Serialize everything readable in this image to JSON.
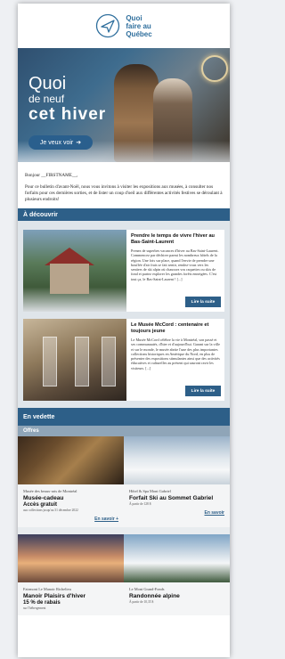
{
  "header": {
    "logo_icon": "compass-arrow-icon",
    "logo_line1": "Quoi",
    "logo_line2": "faire au",
    "logo_line3": "Québec",
    "brand_color": "#2f6f9d"
  },
  "hero": {
    "title_line1": "Quoi",
    "title_line2": "de neuf",
    "title_line3": "cet hiver",
    "button_label": "Je veux voir",
    "button_icon": "arrow-right-icon"
  },
  "intro": {
    "greeting": "Bonjour __FIRSTNAME__,",
    "body": "Pour ce bulletin d'avant-Noël, nous vous invitons à visiter les expositions aux musées, à consulter nos forfaits pour ces dernières sorties, et de lister un coup d'oeil aux différentes activités festives se déroulant à plusieurs endroits!"
  },
  "discover": {
    "title": "À découvrir",
    "articles": [
      {
        "title": "Prendre le temps de vivre l'hiver au Bas-Saint-Laurent",
        "body": "Prenez de superbes vacances d'hiver au Bas-Saint-Laurent. Commencez par déchirer parmi les nombreux hôtels de la région. Une fois sur place, quand l'envie de prendre une bouffée d'air frais se fait sentir, rendez-vous vers les sentiers de ski alpin où chaussez vos raquettes ou skis de fond et partez explorer les grandes forêts enneigées. C'est tout ça, le Bas-Saint-Laurent ! [...]",
        "button": "Lire la suite"
      },
      {
        "title": "Le Musée McCord : centenaire et toujours jeune",
        "body": "Le Musée McCord célèbre la vie à Montréal, son passé et ses communautés, d'hier et d'aujourd'hui. Garant sur la ville et sur le monde, le musée abrite l'une des plus importantes collections historiques en Amérique du Nord, en plus de présenter des expositions stimulantes ainsi que des activités éducatives et culturelles au présent qui sauront ravir les visiteurs. [...]",
        "button": "Lire la suite"
      }
    ]
  },
  "featured": {
    "title": "En vedette",
    "offers_label": "Offres",
    "offers": [
      {
        "venue": "Musée des beaux-arts de Montréal",
        "name": "Musée-cadeau",
        "price": "Accès gratuit",
        "small": "aux collections jusqu'au 31 décembre 2022",
        "link": "En savoir +"
      },
      {
        "venue": "Hôtel & Spa Mont Gabriel",
        "name": "Forfait Ski au Sommet Gabriel",
        "price": "",
        "small": "À partir de 128 $",
        "link": "En savoir"
      },
      {
        "venue": "Fairmont Le Manoir Richelieu",
        "name": "Manoir Plaisirs d'hiver",
        "price": "15 % de rabais",
        "small": "sur l'hébergement",
        "link": ""
      },
      {
        "venue": "Le Mont Grand-Fonds",
        "name": "Randonnée alpine",
        "price": "",
        "small": "À partir de 10,35 $",
        "link": ""
      }
    ]
  }
}
